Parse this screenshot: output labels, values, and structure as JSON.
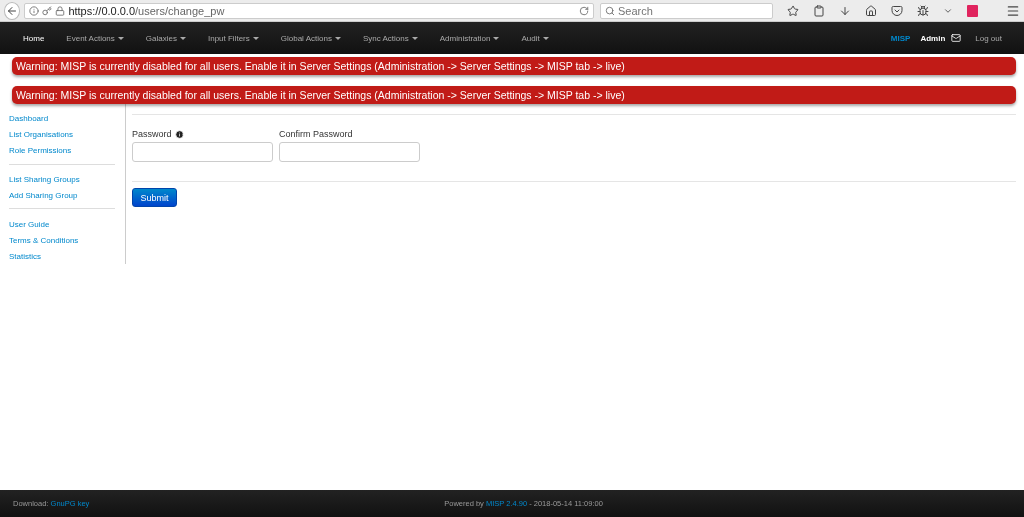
{
  "browser": {
    "url_host": "https://0.0.0.0",
    "url_path": "/users/change_pw",
    "search": {
      "placeholder": "Search"
    }
  },
  "navbar": {
    "items": [
      {
        "label": "Home",
        "dropdown": false,
        "selected": true
      },
      {
        "label": "Event Actions",
        "dropdown": true,
        "selected": false
      },
      {
        "label": "Galaxies",
        "dropdown": true,
        "selected": false
      },
      {
        "label": "Input Filters",
        "dropdown": true,
        "selected": false
      },
      {
        "label": "Global Actions",
        "dropdown": true,
        "selected": false
      },
      {
        "label": "Sync Actions",
        "dropdown": true,
        "selected": false
      },
      {
        "label": "Administration",
        "dropdown": true,
        "selected": false
      },
      {
        "label": "Audit",
        "dropdown": true,
        "selected": false
      }
    ],
    "brand": "MISP",
    "user": "Admin",
    "logout": "Log out"
  },
  "banners": [
    "Warning: MISP is currently disabled for all users. Enable it in Server Settings (Administration -> Server Settings -> MISP tab -> live)",
    "Warning: MISP is currently disabled for all users. Enable it in Server Settings (Administration -> Server Settings -> MISP tab -> live)"
  ],
  "sidebar": {
    "groups": [
      [
        "Dashboard",
        "List Organisations",
        "Role Permissions"
      ],
      [
        "List Sharing Groups",
        "Add Sharing Group"
      ],
      [
        "User Guide",
        "Terms & Conditions",
        "Statistics"
      ]
    ]
  },
  "form": {
    "fields": [
      {
        "label": "Password",
        "info": true
      },
      {
        "label": "Confirm Password",
        "info": false
      }
    ],
    "submit": "Submit"
  },
  "footer": {
    "download_label": "Download:",
    "download_link": "GnuPG key",
    "powered_label": "Powered by",
    "powered_link": "MISP 2.4.90",
    "timestamp": "- 2018-05-14 11:09:00"
  }
}
